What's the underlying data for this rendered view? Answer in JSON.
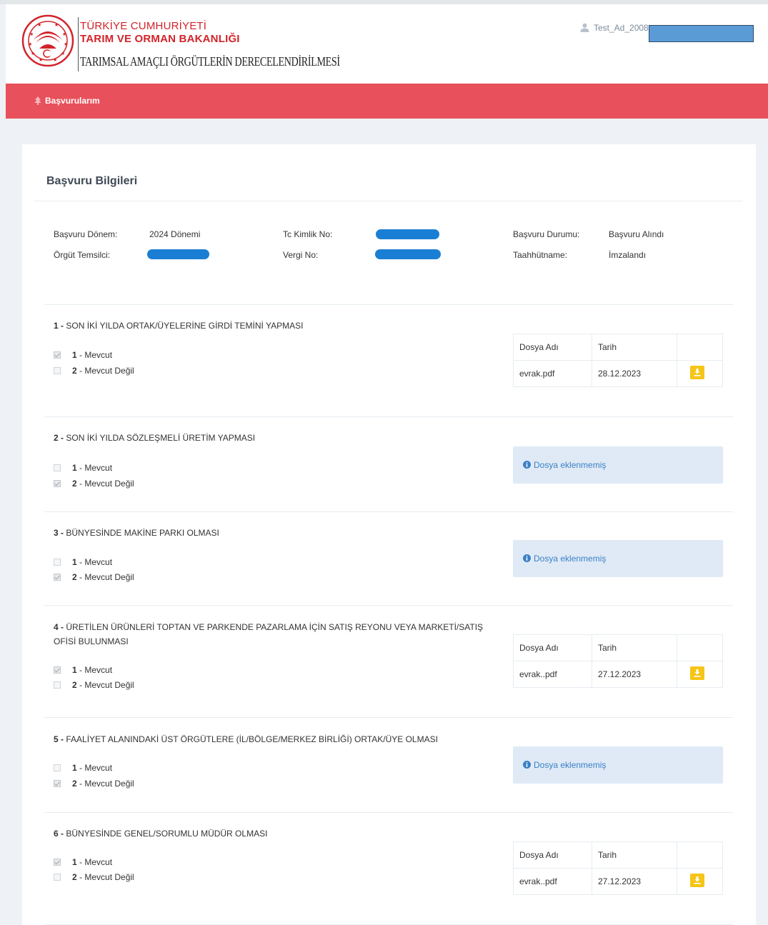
{
  "header": {
    "brand_line1": "TÜRKİYE CUMHURİYETİ",
    "brand_line2": "TARIM VE ORMAN BAKANLIĞI",
    "brand_line3": "TARIMSAL AMAÇLI ÖRGÜTLERİN DERECELENDİRİLMESİ",
    "user_name": "Test_Ad_2008",
    "user_icon": "user-icon",
    "logo": "ministry-logo"
  },
  "nav": {
    "item_label": "Başvurularım",
    "item_icon": "tree-icon"
  },
  "colors": {
    "nav_bg": "#e8505b",
    "brand_red": "#d2232a",
    "download_btn": "#f5c518",
    "alert_bg": "#dfeaf6",
    "alert_text": "#3b80c6",
    "mask_blue": "#1a7fd4"
  },
  "card": {
    "title": "Başvuru Bilgileri",
    "info": {
      "donem_label": "Başvuru Dönem:",
      "donem_value": "2024 Dönemi",
      "temsilci_label": "Örgüt Temsilci:",
      "tc_label": "Tc Kimlik No:",
      "vergi_label": "Vergi No:",
      "durum_label": "Başvuru Durumu:",
      "durum_value": "Başvuru Alındı",
      "taahhut_label": "Taahhütname:",
      "taahhut_value": "İmzalandı"
    }
  },
  "file_table_headers": {
    "file_name": "Dosya Adı",
    "date": "Tarih"
  },
  "alert_text": "Dosya eklenmemiş",
  "questions": [
    {
      "no": "1",
      "sep": " - ",
      "title": "SON İKİ YILDA ORTAK/ÜYELERİNE GİRDİ TEMİNİ YAPMASI",
      "options": [
        {
          "no": "1",
          "label": " - Mevcut",
          "checked": true
        },
        {
          "no": "2",
          "label": " - Mevcut Değil",
          "checked": false
        }
      ],
      "file": {
        "name": "evrak.pdf",
        "date": "28.12.2023"
      }
    },
    {
      "no": "2",
      "sep": " - ",
      "title": "SON İKİ YILDA SÖZLEŞMELİ ÜRETİM YAPMASI",
      "options": [
        {
          "no": "1",
          "label": " - Mevcut",
          "checked": false
        },
        {
          "no": "2",
          "label": " - Mevcut Değil",
          "checked": true
        }
      ],
      "file": null
    },
    {
      "no": "3",
      "sep": " - ",
      "title": "BÜNYESİNDE MAKİNE PARKI OLMASI",
      "options": [
        {
          "no": "1",
          "label": " - Mevcut",
          "checked": false
        },
        {
          "no": "2",
          "label": " - Mevcut Değil",
          "checked": true
        }
      ],
      "file": null
    },
    {
      "no": "4",
      "sep": " - ",
      "title": "ÜRETİLEN ÜRÜNLERİ TOPTAN VE PARKENDE PAZARLAMA İÇİN SATIŞ REYONU VEYA MARKETİ/SATIŞ OFİSİ BULUNMASI",
      "options": [
        {
          "no": "1",
          "label": " - Mevcut",
          "checked": true
        },
        {
          "no": "2",
          "label": " - Mevcut Değil",
          "checked": false
        }
      ],
      "file": {
        "name": "evrak..pdf",
        "date": "27.12.2023"
      }
    },
    {
      "no": "5",
      "sep": " - ",
      "title": "FAALİYET ALANINDAKİ ÜST ÖRGÜTLERE (İL/BÖLGE/MERKEZ BİRLİĞİ) ORTAK/ÜYE OLMASI",
      "options": [
        {
          "no": "1",
          "label": " - Mevcut",
          "checked": false
        },
        {
          "no": "2",
          "label": " - Mevcut Değil",
          "checked": true
        }
      ],
      "file": null
    },
    {
      "no": "6",
      "sep": " - ",
      "title": "BÜNYESİNDE GENEL/SORUMLU MÜDÜR OLMASI",
      "options": [
        {
          "no": "1",
          "label": " - Mevcut",
          "checked": true
        },
        {
          "no": "2",
          "label": " - Mevcut Değil",
          "checked": false
        }
      ],
      "file": {
        "name": "evrak..pdf",
        "date": "27.12.2023"
      }
    }
  ]
}
